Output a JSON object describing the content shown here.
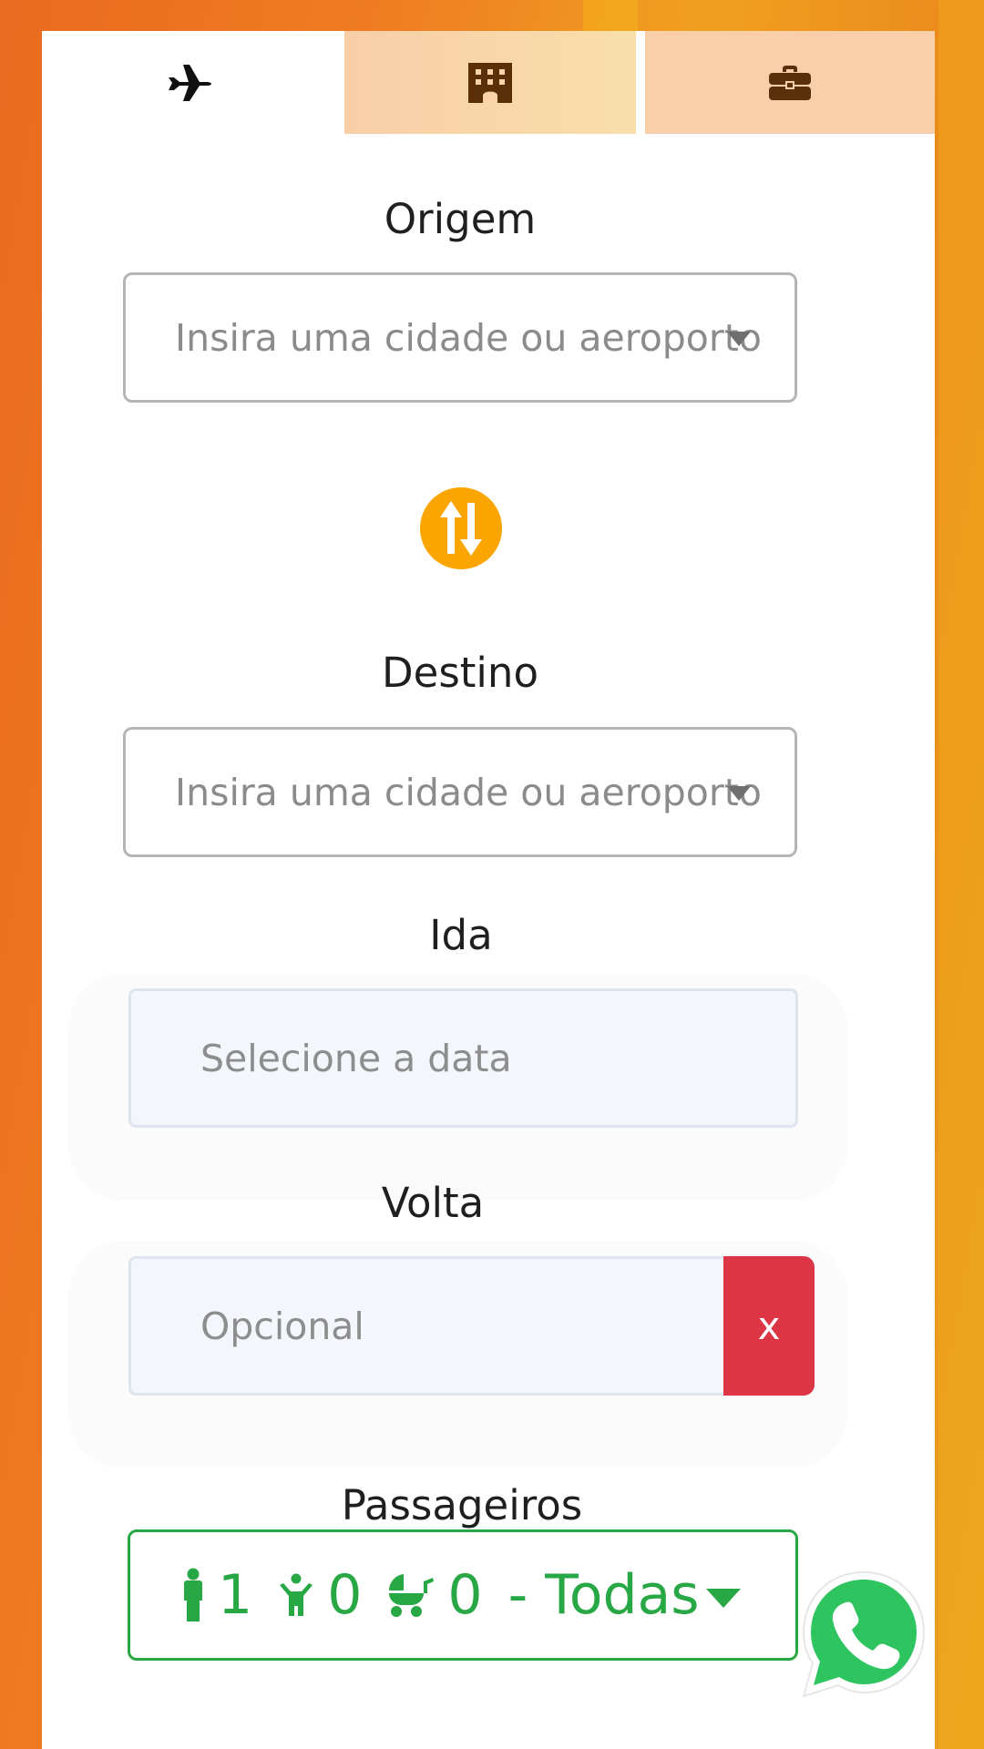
{
  "tabs": [
    {
      "icon": "plane-icon",
      "active": true
    },
    {
      "icon": "hotel-icon",
      "active": false
    },
    {
      "icon": "suitcase-icon",
      "active": false
    }
  ],
  "origin": {
    "label": "Origem",
    "placeholder": "Insira uma cidade ou aeroporto"
  },
  "swap": {
    "icon": "swap-arrows-icon"
  },
  "destination": {
    "label": "Destino",
    "placeholder": "Insira uma cidade ou aeroporto"
  },
  "departure": {
    "label": "Ida",
    "placeholder": "Selecione a data"
  },
  "return": {
    "label": "Volta",
    "placeholder": "Opcional",
    "clear_label": "x"
  },
  "passengers": {
    "label": "Passageiros",
    "adults": "1",
    "children": "0",
    "infants": "0",
    "cabin": "- Todas"
  },
  "colors": {
    "accent_orange": "#fba500",
    "success_green": "#28a745",
    "danger_red": "#dc3545",
    "whatsapp_green": "#25d366"
  },
  "whatsapp": {
    "icon": "whatsapp-icon"
  }
}
